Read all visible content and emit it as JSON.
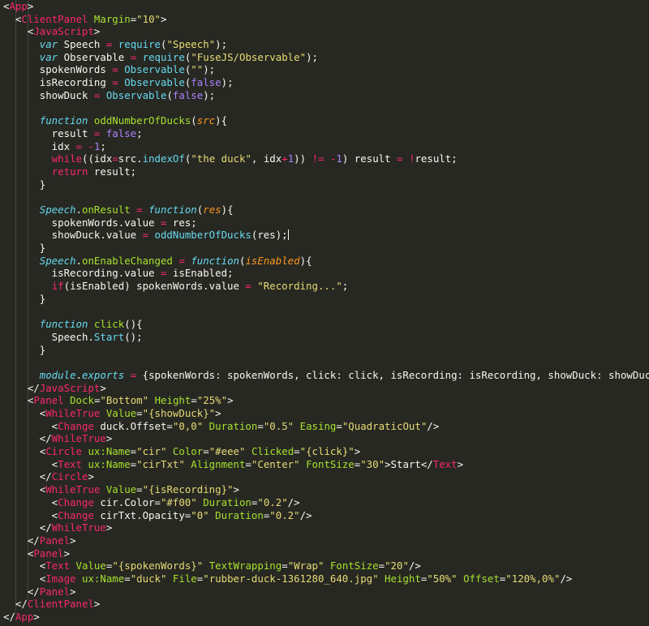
{
  "colors": {
    "background": "#272822",
    "text": "#f8f8f2",
    "tag": "#f92672",
    "attribute": "#a6e22e",
    "string": "#e6db74",
    "keyword": "#66d9ef",
    "parameter": "#fd971f",
    "number": "#ae81ff",
    "guide": "#464741"
  },
  "code_lines": [
    [
      [
        "t",
        "<"
      ],
      [
        "g",
        "App"
      ],
      [
        "t",
        ">"
      ]
    ],
    [
      [
        "t",
        "  <"
      ],
      [
        "g",
        "ClientPanel"
      ],
      [
        "t",
        " "
      ],
      [
        "a",
        "Margin"
      ],
      [
        "t",
        "="
      ],
      [
        "s",
        "\"10\""
      ],
      [
        "t",
        ">"
      ]
    ],
    [
      [
        "t",
        "    <"
      ],
      [
        "g",
        "JavaScript"
      ],
      [
        "t",
        ">"
      ]
    ],
    [
      [
        "t",
        "      "
      ],
      [
        "ki",
        "var"
      ],
      [
        "t",
        " Speech "
      ],
      [
        "g",
        "="
      ],
      [
        "t",
        " "
      ],
      [
        "k",
        "require"
      ],
      [
        "t",
        "("
      ],
      [
        "s",
        "\"Speech\""
      ],
      [
        "t",
        ");"
      ]
    ],
    [
      [
        "t",
        "      "
      ],
      [
        "ki",
        "var"
      ],
      [
        "t",
        " Observable "
      ],
      [
        "g",
        "="
      ],
      [
        "t",
        " "
      ],
      [
        "k",
        "require"
      ],
      [
        "t",
        "("
      ],
      [
        "s",
        "\"FuseJS/Observable\""
      ],
      [
        "t",
        ");"
      ]
    ],
    [
      [
        "t",
        "      spokenWords "
      ],
      [
        "g",
        "="
      ],
      [
        "t",
        " "
      ],
      [
        "k",
        "Observable"
      ],
      [
        "t",
        "("
      ],
      [
        "s",
        "\"\""
      ],
      [
        "t",
        ");"
      ]
    ],
    [
      [
        "t",
        "      isRecording "
      ],
      [
        "g",
        "="
      ],
      [
        "t",
        " "
      ],
      [
        "k",
        "Observable"
      ],
      [
        "t",
        "("
      ],
      [
        "n",
        "false"
      ],
      [
        "t",
        ");"
      ]
    ],
    [
      [
        "t",
        "      showDuck "
      ],
      [
        "g",
        "="
      ],
      [
        "t",
        " "
      ],
      [
        "k",
        "Observable"
      ],
      [
        "t",
        "("
      ],
      [
        "n",
        "false"
      ],
      [
        "t",
        ");"
      ]
    ],
    [],
    [
      [
        "t",
        "      "
      ],
      [
        "ki",
        "function"
      ],
      [
        "t",
        " "
      ],
      [
        "a",
        "oddNumberOfDucks"
      ],
      [
        "t",
        "("
      ],
      [
        "pi",
        "src"
      ],
      [
        "t",
        "){"
      ]
    ],
    [
      [
        "t",
        "        result "
      ],
      [
        "g",
        "="
      ],
      [
        "t",
        " "
      ],
      [
        "n",
        "false"
      ],
      [
        "t",
        ";"
      ]
    ],
    [
      [
        "t",
        "        idx "
      ],
      [
        "g",
        "="
      ],
      [
        "t",
        " "
      ],
      [
        "g",
        "-"
      ],
      [
        "n",
        "1"
      ],
      [
        "t",
        ";"
      ]
    ],
    [
      [
        "t",
        "        "
      ],
      [
        "g",
        "while"
      ],
      [
        "t",
        "((idx"
      ],
      [
        "g",
        "="
      ],
      [
        "t",
        "src."
      ],
      [
        "k",
        "indexOf"
      ],
      [
        "t",
        "("
      ],
      [
        "s",
        "\"the duck\""
      ],
      [
        "t",
        ", idx"
      ],
      [
        "g",
        "+"
      ],
      [
        "n",
        "1"
      ],
      [
        "t",
        ")) "
      ],
      [
        "g",
        "!="
      ],
      [
        "t",
        " "
      ],
      [
        "g",
        "-"
      ],
      [
        "n",
        "1"
      ],
      [
        "t",
        ") result "
      ],
      [
        "g",
        "="
      ],
      [
        "t",
        " "
      ],
      [
        "g",
        "!"
      ],
      [
        "t",
        "result;"
      ]
    ],
    [
      [
        "t",
        "        "
      ],
      [
        "g",
        "return"
      ],
      [
        "t",
        " result;"
      ]
    ],
    [
      [
        "t",
        "      }"
      ]
    ],
    [],
    [
      [
        "t",
        "      "
      ],
      [
        "ki",
        "Speech"
      ],
      [
        "t",
        "."
      ],
      [
        "a",
        "onResult"
      ],
      [
        "t",
        " "
      ],
      [
        "g",
        "="
      ],
      [
        "t",
        " "
      ],
      [
        "ki",
        "function"
      ],
      [
        "t",
        "("
      ],
      [
        "pi",
        "res"
      ],
      [
        "t",
        "){"
      ]
    ],
    [
      [
        "t",
        "        spokenWords.value "
      ],
      [
        "g",
        "="
      ],
      [
        "t",
        " res;"
      ]
    ],
    [
      [
        "t",
        "        showDuck.value "
      ],
      [
        "g",
        "="
      ],
      [
        "t",
        " "
      ],
      [
        "k",
        "oddNumberOfDucks"
      ],
      [
        "t",
        "(res);"
      ],
      [
        "cursor",
        ""
      ]
    ],
    [
      [
        "t",
        "      }"
      ]
    ],
    [
      [
        "t",
        "      "
      ],
      [
        "ki",
        "Speech"
      ],
      [
        "t",
        "."
      ],
      [
        "a",
        "onEnableChanged"
      ],
      [
        "t",
        " "
      ],
      [
        "g",
        "="
      ],
      [
        "t",
        " "
      ],
      [
        "ki",
        "function"
      ],
      [
        "t",
        "("
      ],
      [
        "pi",
        "isEnabled"
      ],
      [
        "t",
        "){"
      ]
    ],
    [
      [
        "t",
        "        isRecording.value "
      ],
      [
        "g",
        "="
      ],
      [
        "t",
        " isEnabled;"
      ]
    ],
    [
      [
        "t",
        "        "
      ],
      [
        "g",
        "if"
      ],
      [
        "t",
        "(isEnabled) spokenWords.value "
      ],
      [
        "g",
        "="
      ],
      [
        "t",
        " "
      ],
      [
        "s",
        "\"Recording...\""
      ],
      [
        "t",
        ";"
      ]
    ],
    [
      [
        "t",
        "      }"
      ]
    ],
    [],
    [
      [
        "t",
        "      "
      ],
      [
        "ki",
        "function"
      ],
      [
        "t",
        " "
      ],
      [
        "a",
        "click"
      ],
      [
        "t",
        "(){"
      ]
    ],
    [
      [
        "t",
        "        Speech."
      ],
      [
        "k",
        "Start"
      ],
      [
        "t",
        "();"
      ]
    ],
    [
      [
        "t",
        "      }"
      ]
    ],
    [],
    [
      [
        "t",
        "      "
      ],
      [
        "ki",
        "module"
      ],
      [
        "t",
        "."
      ],
      [
        "ki",
        "exports"
      ],
      [
        "t",
        " "
      ],
      [
        "g",
        "="
      ],
      [
        "t",
        " {spokenWords: spokenWords, click: click, isRecording: isRecording, showDuck: showDuck};"
      ]
    ],
    [
      [
        "t",
        "    </"
      ],
      [
        "g",
        "JavaScript"
      ],
      [
        "t",
        ">"
      ]
    ],
    [
      [
        "t",
        "    <"
      ],
      [
        "g",
        "Panel"
      ],
      [
        "t",
        " "
      ],
      [
        "a",
        "Dock"
      ],
      [
        "t",
        "="
      ],
      [
        "s",
        "\"Bottom\""
      ],
      [
        "t",
        " "
      ],
      [
        "a",
        "Height"
      ],
      [
        "t",
        "="
      ],
      [
        "s",
        "\"25%\""
      ],
      [
        "t",
        ">"
      ]
    ],
    [
      [
        "t",
        "      <"
      ],
      [
        "g",
        "WhileTrue"
      ],
      [
        "t",
        " "
      ],
      [
        "a",
        "Value"
      ],
      [
        "t",
        "="
      ],
      [
        "s",
        "\"{showDuck}\""
      ],
      [
        "t",
        ">"
      ]
    ],
    [
      [
        "t",
        "        <"
      ],
      [
        "g",
        "Change"
      ],
      [
        "t",
        " duck.Offset="
      ],
      [
        "s",
        "\"0,0\""
      ],
      [
        "t",
        " "
      ],
      [
        "a",
        "Duration"
      ],
      [
        "t",
        "="
      ],
      [
        "s",
        "\"0.5\""
      ],
      [
        "t",
        " "
      ],
      [
        "a",
        "Easing"
      ],
      [
        "t",
        "="
      ],
      [
        "s",
        "\"QuadraticOut\""
      ],
      [
        "t",
        "/>"
      ]
    ],
    [
      [
        "t",
        "      </"
      ],
      [
        "g",
        "WhileTrue"
      ],
      [
        "t",
        ">"
      ]
    ],
    [
      [
        "t",
        "      <"
      ],
      [
        "g",
        "Circle"
      ],
      [
        "t",
        " "
      ],
      [
        "a",
        "ux:Name"
      ],
      [
        "t",
        "="
      ],
      [
        "s",
        "\"cir\""
      ],
      [
        "t",
        " "
      ],
      [
        "a",
        "Color"
      ],
      [
        "t",
        "="
      ],
      [
        "s",
        "\"#eee\""
      ],
      [
        "t",
        " "
      ],
      [
        "a",
        "Clicked"
      ],
      [
        "t",
        "="
      ],
      [
        "s",
        "\"{click}\""
      ],
      [
        "t",
        ">"
      ]
    ],
    [
      [
        "t",
        "        <"
      ],
      [
        "g",
        "Text"
      ],
      [
        "t",
        " "
      ],
      [
        "a",
        "ux:Name"
      ],
      [
        "t",
        "="
      ],
      [
        "s",
        "\"cirTxt\""
      ],
      [
        "t",
        " "
      ],
      [
        "a",
        "Alignment"
      ],
      [
        "t",
        "="
      ],
      [
        "s",
        "\"Center\""
      ],
      [
        "t",
        " "
      ],
      [
        "a",
        "FontSize"
      ],
      [
        "t",
        "="
      ],
      [
        "s",
        "\"30\""
      ],
      [
        "t",
        ">Start</"
      ],
      [
        "g",
        "Text"
      ],
      [
        "t",
        ">"
      ]
    ],
    [
      [
        "t",
        "      </"
      ],
      [
        "g",
        "Circle"
      ],
      [
        "t",
        ">"
      ]
    ],
    [
      [
        "t",
        "      <"
      ],
      [
        "g",
        "WhileTrue"
      ],
      [
        "t",
        " "
      ],
      [
        "a",
        "Value"
      ],
      [
        "t",
        "="
      ],
      [
        "s",
        "\"{isRecording}\""
      ],
      [
        "t",
        ">"
      ]
    ],
    [
      [
        "t",
        "        <"
      ],
      [
        "g",
        "Change"
      ],
      [
        "t",
        " cir.Color="
      ],
      [
        "s",
        "\"#f00\""
      ],
      [
        "t",
        " "
      ],
      [
        "a",
        "Duration"
      ],
      [
        "t",
        "="
      ],
      [
        "s",
        "\"0.2\""
      ],
      [
        "t",
        "/>"
      ]
    ],
    [
      [
        "t",
        "        <"
      ],
      [
        "g",
        "Change"
      ],
      [
        "t",
        " cirTxt.Opacity="
      ],
      [
        "s",
        "\"0\""
      ],
      [
        "t",
        " "
      ],
      [
        "a",
        "Duration"
      ],
      [
        "t",
        "="
      ],
      [
        "s",
        "\"0.2\""
      ],
      [
        "t",
        "/>"
      ]
    ],
    [
      [
        "t",
        "      </"
      ],
      [
        "g",
        "WhileTrue"
      ],
      [
        "t",
        ">"
      ]
    ],
    [
      [
        "t",
        "    </"
      ],
      [
        "g",
        "Panel"
      ],
      [
        "t",
        ">"
      ]
    ],
    [
      [
        "t",
        "    <"
      ],
      [
        "g",
        "Panel"
      ],
      [
        "t",
        ">"
      ]
    ],
    [
      [
        "t",
        "      <"
      ],
      [
        "g",
        "Text"
      ],
      [
        "t",
        " "
      ],
      [
        "a",
        "Value"
      ],
      [
        "t",
        "="
      ],
      [
        "s",
        "\"{spokenWords}\""
      ],
      [
        "t",
        " "
      ],
      [
        "a",
        "TextWrapping"
      ],
      [
        "t",
        "="
      ],
      [
        "s",
        "\"Wrap\""
      ],
      [
        "t",
        " "
      ],
      [
        "a",
        "FontSize"
      ],
      [
        "t",
        "="
      ],
      [
        "s",
        "\"20\""
      ],
      [
        "t",
        "/>"
      ]
    ],
    [
      [
        "t",
        "      <"
      ],
      [
        "g",
        "Image"
      ],
      [
        "t",
        " "
      ],
      [
        "a",
        "ux:Name"
      ],
      [
        "t",
        "="
      ],
      [
        "s",
        "\"duck\""
      ],
      [
        "t",
        " "
      ],
      [
        "a",
        "File"
      ],
      [
        "t",
        "="
      ],
      [
        "s",
        "\"rubber-duck-1361280_640.jpg\""
      ],
      [
        "t",
        " "
      ],
      [
        "a",
        "Height"
      ],
      [
        "t",
        "="
      ],
      [
        "s",
        "\"50%\""
      ],
      [
        "t",
        " "
      ],
      [
        "a",
        "Offset"
      ],
      [
        "t",
        "="
      ],
      [
        "s",
        "\"120%,0%\""
      ],
      [
        "t",
        "/>"
      ]
    ],
    [
      [
        "t",
        "    </"
      ],
      [
        "g",
        "Panel"
      ],
      [
        "t",
        ">"
      ]
    ],
    [
      [
        "t",
        "  </"
      ],
      [
        "g",
        "ClientPanel"
      ],
      [
        "t",
        ">"
      ]
    ],
    [
      [
        "t",
        "</"
      ],
      [
        "g",
        "App"
      ],
      [
        "t",
        ">"
      ]
    ]
  ]
}
